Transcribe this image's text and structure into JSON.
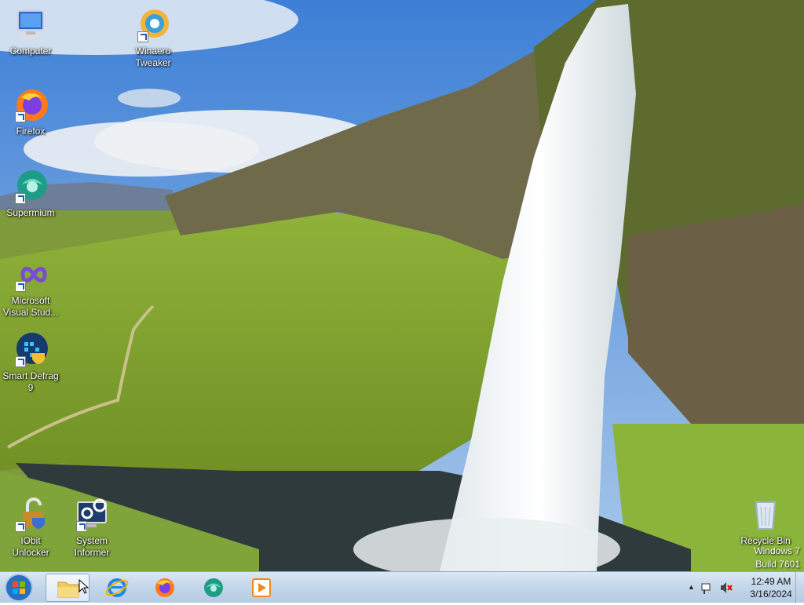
{
  "desktop": {
    "icons": [
      {
        "name": "computer",
        "label": "Computer"
      },
      {
        "name": "winaero-tweaker",
        "label": "Winaero Tweaker"
      },
      {
        "name": "firefox",
        "label": "Firefox"
      },
      {
        "name": "supermium",
        "label": "Supermium"
      },
      {
        "name": "microsoft-visual-studio",
        "label": "Microsoft Visual Stud..."
      },
      {
        "name": "smart-defrag",
        "label": "Smart Defrag 9"
      },
      {
        "name": "iobit-unlocker",
        "label": "IObit Unlocker"
      },
      {
        "name": "system-informer",
        "label": "System Informer"
      },
      {
        "name": "recycle-bin",
        "label": "Recycle Bin"
      }
    ],
    "watermark": {
      "line1": "Windows 7",
      "line2": "Build 7601"
    }
  },
  "taskbar": {
    "start_icon": "windows-orb-icon",
    "pinned": [
      {
        "name": "file-explorer",
        "icon": "folder-icon",
        "active": true
      },
      {
        "name": "internet-explorer",
        "icon": "internet-explorer-icon",
        "active": false
      },
      {
        "name": "firefox",
        "icon": "firefox-icon",
        "active": false
      },
      {
        "name": "supermium",
        "icon": "supermium-icon",
        "active": false
      },
      {
        "name": "media-player",
        "icon": "media-player-icon",
        "active": false
      }
    ],
    "tray": {
      "time": "12:49 AM",
      "date": "3/16/2024"
    }
  },
  "colors": {
    "taskbar_top": "#dbe7f4",
    "taskbar_bottom": "#b5cbe2",
    "accent": "#1a5fb4"
  }
}
